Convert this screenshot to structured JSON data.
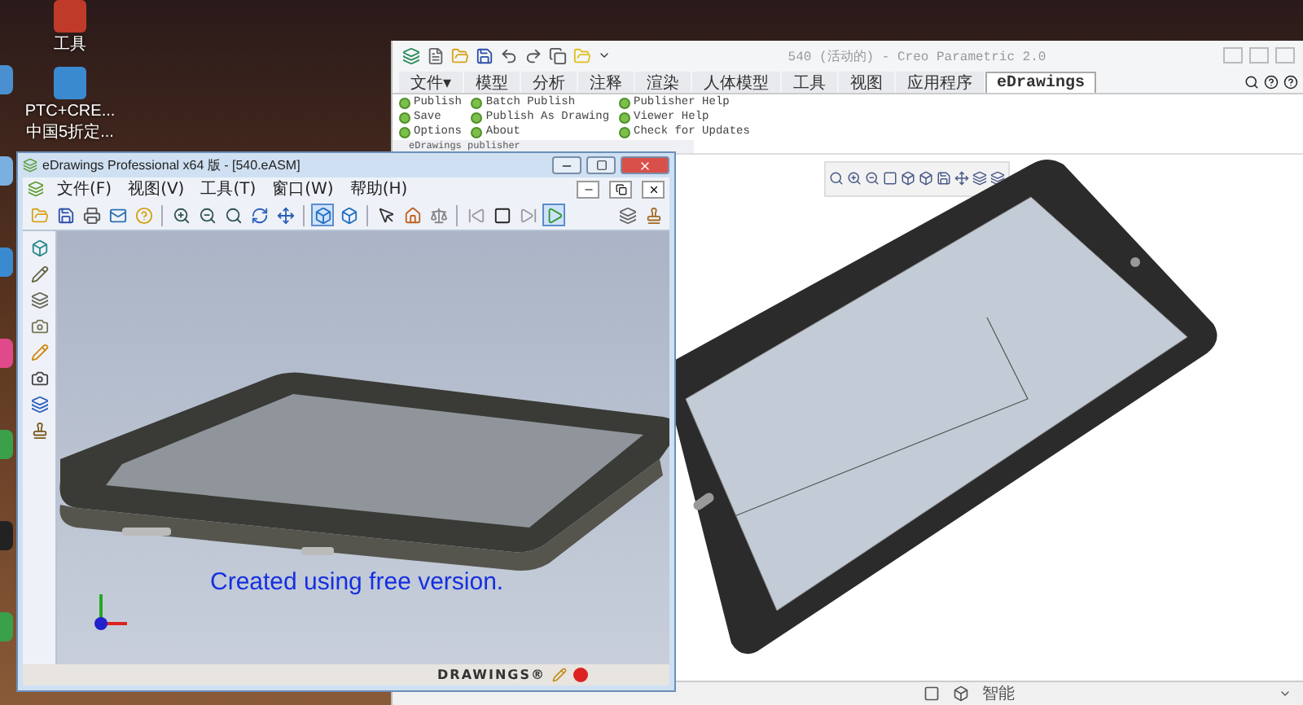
{
  "desktop": {
    "icons": [
      {
        "lines": [
          "工具"
        ]
      },
      {
        "lines": [
          "PTC+CRE...",
          "中国5折定..."
        ]
      }
    ]
  },
  "creo": {
    "title": "540 (活动的) - Creo Parametric 2.0",
    "tabs": [
      {
        "label": "文件▾",
        "selected": false
      },
      {
        "label": "模型",
        "selected": false
      },
      {
        "label": "分析",
        "selected": false
      },
      {
        "label": "注释",
        "selected": false
      },
      {
        "label": "渲染",
        "selected": false
      },
      {
        "label": "人体模型",
        "selected": false
      },
      {
        "label": "工具",
        "selected": false
      },
      {
        "label": "视图",
        "selected": false
      },
      {
        "label": "应用程序",
        "selected": false
      },
      {
        "label": "eDrawings",
        "selected": true
      }
    ],
    "ribbon": {
      "columns": [
        [
          "Publish",
          "Save",
          "Options"
        ],
        [
          "Batch Publish",
          "Publish As Drawing",
          "About"
        ],
        [
          "Publisher Help",
          "Viewer Help",
          "Check for Updates"
        ]
      ],
      "group_label": "eDrawings publisher"
    },
    "status": {
      "filter": "智能"
    }
  },
  "edrawings": {
    "title": "eDrawings Professional x64 版 - [540.eASM]",
    "menu": [
      "文件(F)",
      "视图(V)",
      "工具(T)",
      "窗口(W)",
      "帮助(H)"
    ],
    "notice": "Created using free version.",
    "logo": "DRAWINGS®"
  }
}
